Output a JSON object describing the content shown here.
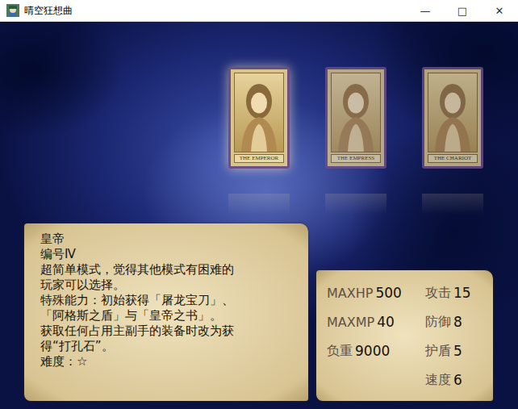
{
  "window": {
    "title": "晴空狂想曲",
    "controls": [
      "—",
      "□",
      "✕"
    ]
  },
  "cards": [
    {
      "label": "THE EMPEROR",
      "selected": true
    },
    {
      "label": "THE EMPRESS",
      "selected": false
    },
    {
      "label": "THE CHARIOT",
      "selected": false
    }
  ],
  "description": {
    "lines": [
      "皇帝",
      "编号Ⅳ",
      "超简单模式，觉得其他模式有困难的",
      "玩家可以选择。",
      "特殊能力：初始获得「屠龙宝刀」、",
      "「阿格斯之盾」与「皇帝之书」。",
      "获取任何占用主副手的装备时改为获",
      "得“打孔石”。",
      "难度：☆"
    ]
  },
  "stats": {
    "left": [
      {
        "label": "MAXHP",
        "value": "500"
      },
      {
        "label": "MAXMP",
        "value": "40"
      },
      {
        "label": "负重",
        "value": "9000"
      }
    ],
    "right": [
      {
        "label": "攻击",
        "value": "15"
      },
      {
        "label": "防御",
        "value": "8"
      },
      {
        "label": "护盾",
        "value": "5"
      },
      {
        "label": "速度",
        "value": "6"
      }
    ]
  }
}
